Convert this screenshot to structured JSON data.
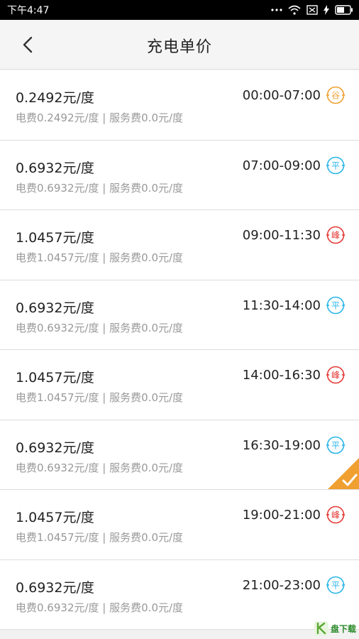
{
  "status_bar": {
    "time": "下午4:47",
    "icons": [
      "more-dots-icon",
      "wifi-icon",
      "sim-off-icon",
      "charging-bolt-icon",
      "battery-icon"
    ]
  },
  "header": {
    "title": "充电单价",
    "back_icon": "chevron-left-icon"
  },
  "rows": [
    {
      "price": "0.2492元/度",
      "detail": "电费0.2492元/度 | 服务费0.0元/度",
      "period": "00:00-07:00",
      "badge": "谷",
      "badge_color": "#f0a030",
      "selected": false
    },
    {
      "price": "0.6932元/度",
      "detail": "电费0.6932元/度 | 服务费0.0元/度",
      "period": "07:00-09:00",
      "badge": "平",
      "badge_color": "#29b6e8",
      "selected": false
    },
    {
      "price": "1.0457元/度",
      "detail": "电费1.0457元/度 | 服务费0.0元/度",
      "period": "09:00-11:30",
      "badge": "峰",
      "badge_color": "#e53935",
      "selected": false
    },
    {
      "price": "0.6932元/度",
      "detail": "电费0.6932元/度 | 服务费0.0元/度",
      "period": "11:30-14:00",
      "badge": "平",
      "badge_color": "#29b6e8",
      "selected": false
    },
    {
      "price": "1.0457元/度",
      "detail": "电费1.0457元/度 | 服务费0.0元/度",
      "period": "14:00-16:30",
      "badge": "峰",
      "badge_color": "#e53935",
      "selected": false
    },
    {
      "price": "0.6932元/度",
      "detail": "电费0.6932元/度 | 服务费0.0元/度",
      "period": "16:30-19:00",
      "badge": "平",
      "badge_color": "#29b6e8",
      "selected": true
    },
    {
      "price": "1.0457元/度",
      "detail": "电费1.0457元/度 | 服务费0.0元/度",
      "period": "19:00-21:00",
      "badge": "峰",
      "badge_color": "#e53935",
      "selected": false
    },
    {
      "price": "0.6932元/度",
      "detail": "电费0.6932元/度 | 服务费0.0元/度",
      "period": "21:00-23:00",
      "badge": "平",
      "badge_color": "#29b6e8",
      "selected": false
    }
  ],
  "colors": {
    "selected_check": "#f0a030",
    "divider": "#dcdcdc"
  },
  "watermark": {
    "text": "盘下载"
  }
}
